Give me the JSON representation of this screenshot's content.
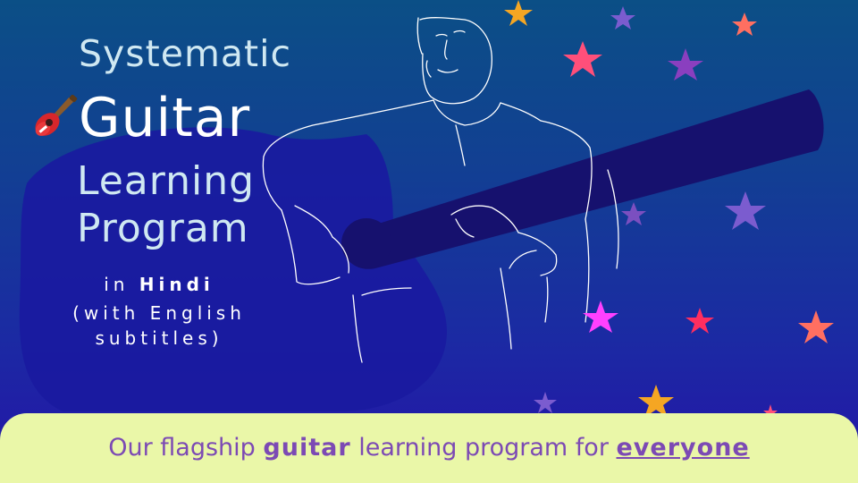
{
  "title": {
    "line1": "Systematic",
    "line2": "Guitar",
    "line3": "Learning",
    "line4": "Program"
  },
  "subtitle": {
    "prefix": "in",
    "language": "Hindi",
    "line2": "(with English",
    "line3": "subtitles)"
  },
  "footer": {
    "part1": "Our flagship ",
    "emphasis": "guitar",
    "part2": " learning program for ",
    "link": "everyone"
  },
  "colors": {
    "background_top": "#0b4f86",
    "background_bottom": "#2513a8",
    "footer_bg": "#eaf7a8",
    "footer_text": "#7c4ab4",
    "title_text": "#cfe8f2"
  },
  "icons": [
    "guitar-icon",
    "star-icon"
  ]
}
